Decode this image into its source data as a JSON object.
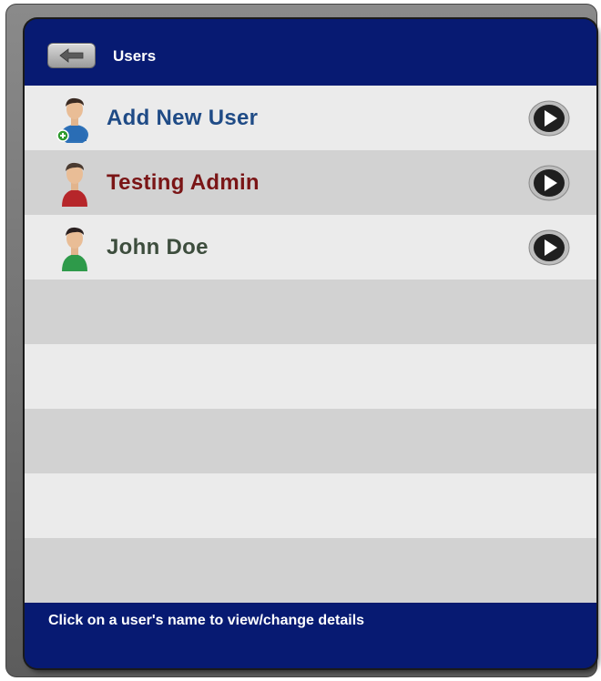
{
  "header": {
    "title": "Users",
    "back_icon": "left-arrow-icon"
  },
  "users": [
    {
      "name": "Add New User",
      "icon": "add-user-icon",
      "color": "#1f4b86"
    },
    {
      "name": "Testing Admin",
      "icon": "user-red-icon",
      "color": "#7a1516"
    },
    {
      "name": "John Doe",
      "icon": "user-green-icon",
      "color": "#3d4d3d"
    }
  ],
  "footer": {
    "hint": "Click on a user's name to view/change details"
  },
  "colors": {
    "bar_background": "#071a72",
    "row_light": "#ebebeb",
    "row_dark": "#d2d2d2"
  }
}
